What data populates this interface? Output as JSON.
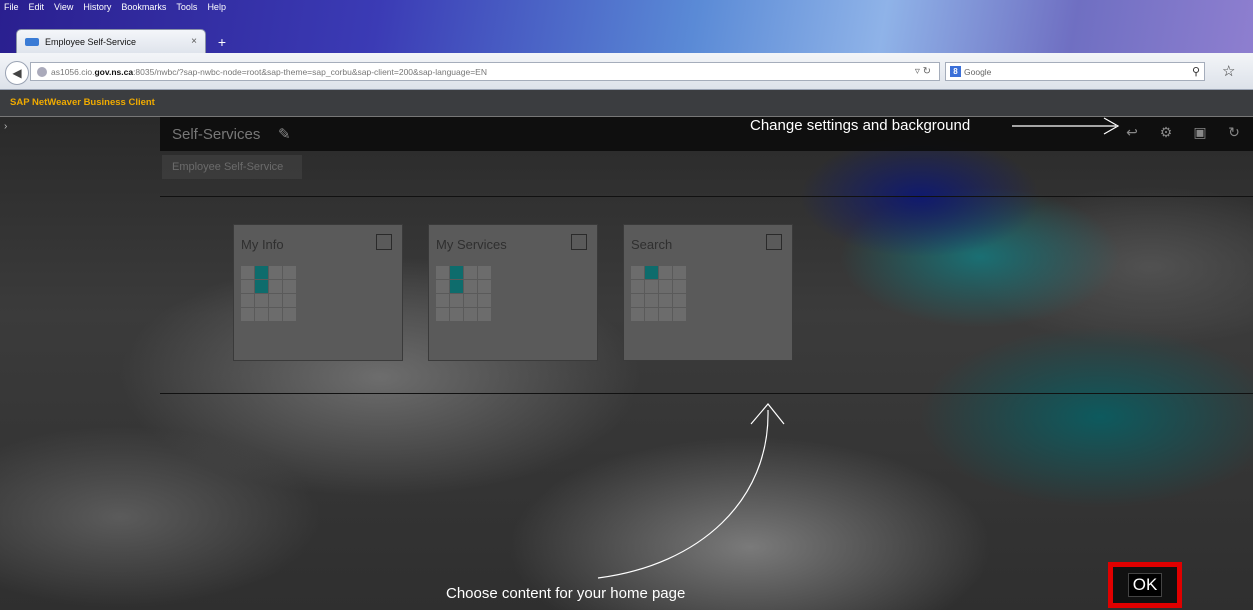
{
  "browser": {
    "menu": [
      "File",
      "Edit",
      "View",
      "History",
      "Bookmarks",
      "Tools",
      "Help"
    ],
    "tab_title": "Employee Self-Service",
    "tab_close": "×",
    "new_tab": "+",
    "url_prefix": "as1056.cio.",
    "url_host": "gov.ns.ca",
    "url_path": ":8035/nwbc/?sap-nwbc-node=root&sap-theme=sap_corbu&sap-client=200&sap-language=EN",
    "search_placeholder": "Google"
  },
  "sap": {
    "brand": "SAP NetWeaver Business Client",
    "page_title": "Self-Services",
    "subtab": "Employee Self-Service"
  },
  "tiles": [
    {
      "name": "My Info",
      "cells": [
        0,
        1,
        0,
        0,
        0,
        1,
        0,
        0,
        0,
        0,
        0,
        0,
        0,
        0,
        0,
        0
      ]
    },
    {
      "name": "My Services",
      "cells": [
        0,
        1,
        0,
        0,
        0,
        1,
        0,
        0,
        0,
        0,
        0,
        0,
        0,
        0,
        0,
        0
      ]
    },
    {
      "name": "Search",
      "cells": [
        0,
        1,
        0,
        0,
        0,
        0,
        0,
        0,
        0,
        0,
        0,
        0,
        0,
        0,
        0,
        0
      ]
    }
  ],
  "annotations": {
    "settings": "Change settings and background",
    "content": "Choose content for your home page"
  },
  "ok_label": "OK"
}
